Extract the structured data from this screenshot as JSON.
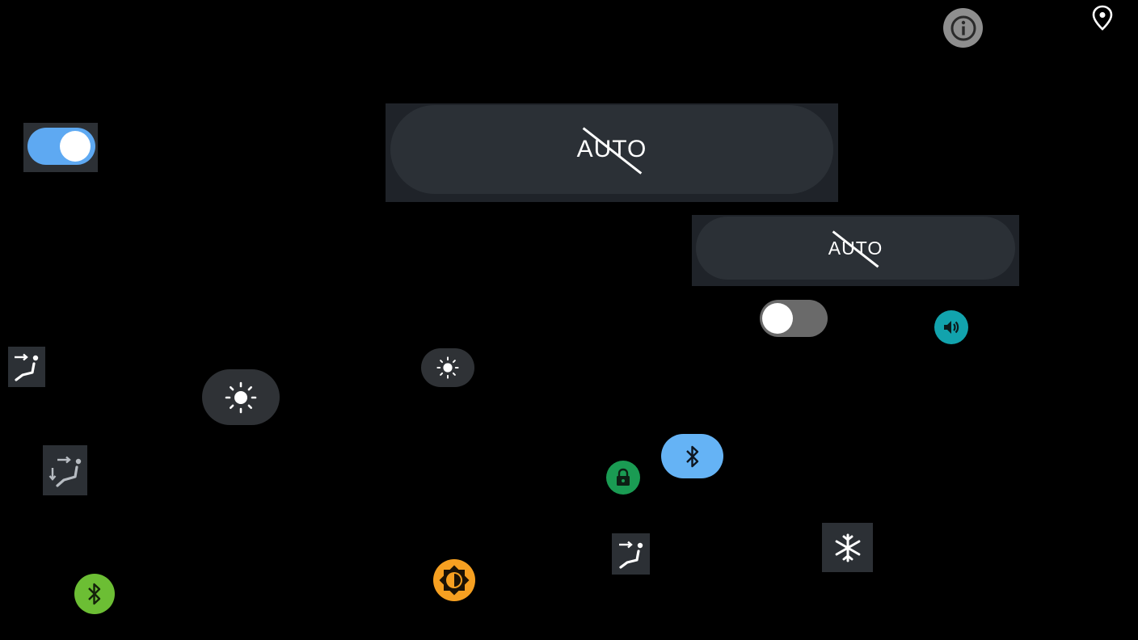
{
  "panels": {
    "auto_large": {
      "label": "AUTO"
    },
    "auto_small": {
      "label": "AUTO"
    }
  },
  "toggles": {
    "primary": {
      "state": "on"
    },
    "secondary": {
      "state": "off"
    }
  },
  "icons": [
    "info-icon",
    "location-pin-icon",
    "volume-icon",
    "seat-airflow-icon",
    "seat-airflow-down-icon",
    "brightness-icon",
    "lock-icon",
    "bluetooth-icon",
    "auto-brightness-icon",
    "snowflake-icon"
  ],
  "colors": {
    "background": "#000000",
    "panel": "#1f2329",
    "pill": "#2b3036",
    "toggle_on": "#5ea9f2",
    "toggle_off": "#6a6a6a",
    "volume": "#12a3ad",
    "lock": "#1a9b53",
    "bluetooth_blue": "#65b3f5",
    "bluetooth_green": "#6cbe34",
    "auto_brightness": "#f6a021",
    "info": "#8e8e8e"
  }
}
